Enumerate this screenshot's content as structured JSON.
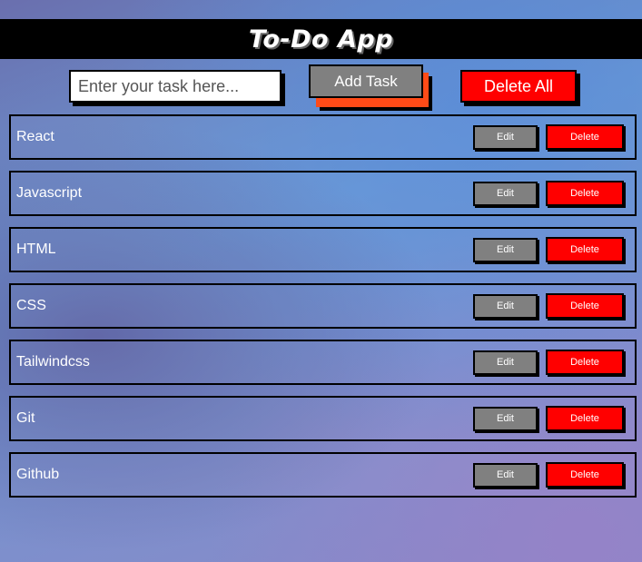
{
  "header": {
    "title": "To-Do App"
  },
  "controls": {
    "input_placeholder": "Enter your task here...",
    "input_value": "",
    "add_label": "Add Task",
    "delete_all_label": "Delete All"
  },
  "tasks": [
    {
      "text": "React",
      "edit_label": "Edit",
      "delete_label": "Delete"
    },
    {
      "text": "Javascript",
      "edit_label": "Edit",
      "delete_label": "Delete"
    },
    {
      "text": "HTML",
      "edit_label": "Edit",
      "delete_label": "Delete"
    },
    {
      "text": "CSS",
      "edit_label": "Edit",
      "delete_label": "Delete"
    },
    {
      "text": "Tailwindcss",
      "edit_label": "Edit",
      "delete_label": "Delete"
    },
    {
      "text": "Git",
      "edit_label": "Edit",
      "delete_label": "Delete"
    },
    {
      "text": "Github",
      "edit_label": "Edit",
      "delete_label": "Delete"
    }
  ],
  "colors": {
    "header_bg": "#000000",
    "add_button": "#808080",
    "add_button_accent": "#ff4b17",
    "delete_button": "#ff0000",
    "edit_button": "#808080"
  }
}
